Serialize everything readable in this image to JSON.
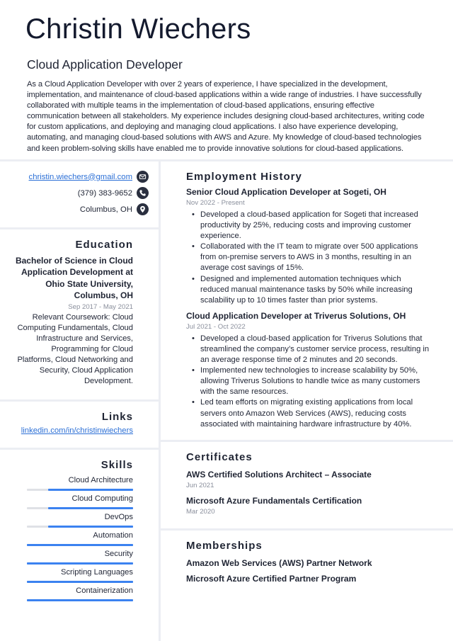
{
  "header": {
    "name": "Christin Wiechers",
    "title": "Cloud Application Developer",
    "summary": "As a Cloud Application Developer with over 2 years of experience, I have specialized in the development, implementation, and maintenance of cloud-based applications within a wide range of industries. I have successfully collaborated with multiple teams in the implementation of cloud-based applications, ensuring effective communication between all stakeholders. My experience includes designing cloud-based architectures, writing code for custom applications, and deploying and managing cloud applications. I also have experience developing, automating, and managing cloud-based solutions with AWS and Azure. My knowledge of cloud-based technologies and keen problem-solving skills have enabled me to provide innovative solutions for cloud-based applications."
  },
  "contact": {
    "email": "christin.wiechers@gmail.com",
    "phone": "(379) 383-9652",
    "location": "Columbus, OH",
    "icons": [
      "envelope-icon",
      "phone-icon",
      "map-pin-icon"
    ]
  },
  "education": {
    "heading": "Education",
    "degree": "Bachelor of Science in Cloud Application Development at Ohio State University, Columbus, OH",
    "dates": "Sep 2017 - May 2021",
    "description": "Relevant Coursework: Cloud Computing Fundamentals, Cloud Infrastructure and Services, Programming for Cloud Platforms, Cloud Networking and Security, Cloud Application Development."
  },
  "links": {
    "heading": "Links",
    "items": [
      "linkedin.com/in/christinwiechers"
    ]
  },
  "skills": {
    "heading": "Skills",
    "items": [
      {
        "name": "Cloud Architecture",
        "level": 0.8
      },
      {
        "name": "Cloud Computing",
        "level": 0.8
      },
      {
        "name": "DevOps",
        "level": 0.8
      },
      {
        "name": "Automation",
        "level": 1.0
      },
      {
        "name": "Security",
        "level": 1.0
      },
      {
        "name": "Scripting Languages",
        "level": 1.0
      },
      {
        "name": "Containerization",
        "level": 1.0
      }
    ]
  },
  "employment": {
    "heading": "Employment History",
    "jobs": [
      {
        "title": "Senior Cloud Application Developer at Sogeti, OH",
        "dates": "Nov 2022 - Present",
        "bullets": [
          "Developed a cloud-based application for Sogeti that increased productivity by 25%, reducing costs and improving customer experience.",
          "Collaborated with the IT team to migrate over 500 applications from on-premise servers to AWS in 3 months, resulting in an average cost savings of 15%.",
          "Designed and implemented automation techniques which reduced manual maintenance tasks by 50% while increasing scalability up to 10 times faster than prior systems."
        ]
      },
      {
        "title": "Cloud Application Developer at Triverus Solutions, OH",
        "dates": "Jul 2021 - Oct 2022",
        "bullets": [
          "Developed a cloud-based application for Triverus Solutions that streamlined the company’s customer service process, resulting in an average response time of 2 minutes and 20 seconds.",
          "Implemented new technologies to increase scalability by 50%, allowing Triverus Solutions to handle twice as many customers with the same resources.",
          "Led team efforts on migrating existing applications from local servers onto Amazon Web Services (AWS), reducing costs associated with maintaining hardware infrastructure by 40%."
        ]
      }
    ]
  },
  "certificates": {
    "heading": "Certificates",
    "items": [
      {
        "name": "AWS Certified Solutions Architect – Associate",
        "date": "Jun 2021"
      },
      {
        "name": "Microsoft Azure Fundamentals Certification",
        "date": "Mar 2020"
      }
    ]
  },
  "memberships": {
    "heading": "Memberships",
    "items": [
      "Amazon Web Services (AWS) Partner Network",
      "Microsoft Azure Certified Partner Program"
    ]
  },
  "colors": {
    "accent": "#3b82f0",
    "link": "#2b6fd6",
    "text": "#1f2433",
    "muted": "#8a8f9c",
    "background": "#eceef3",
    "bar_track": "#dfe1e6"
  }
}
